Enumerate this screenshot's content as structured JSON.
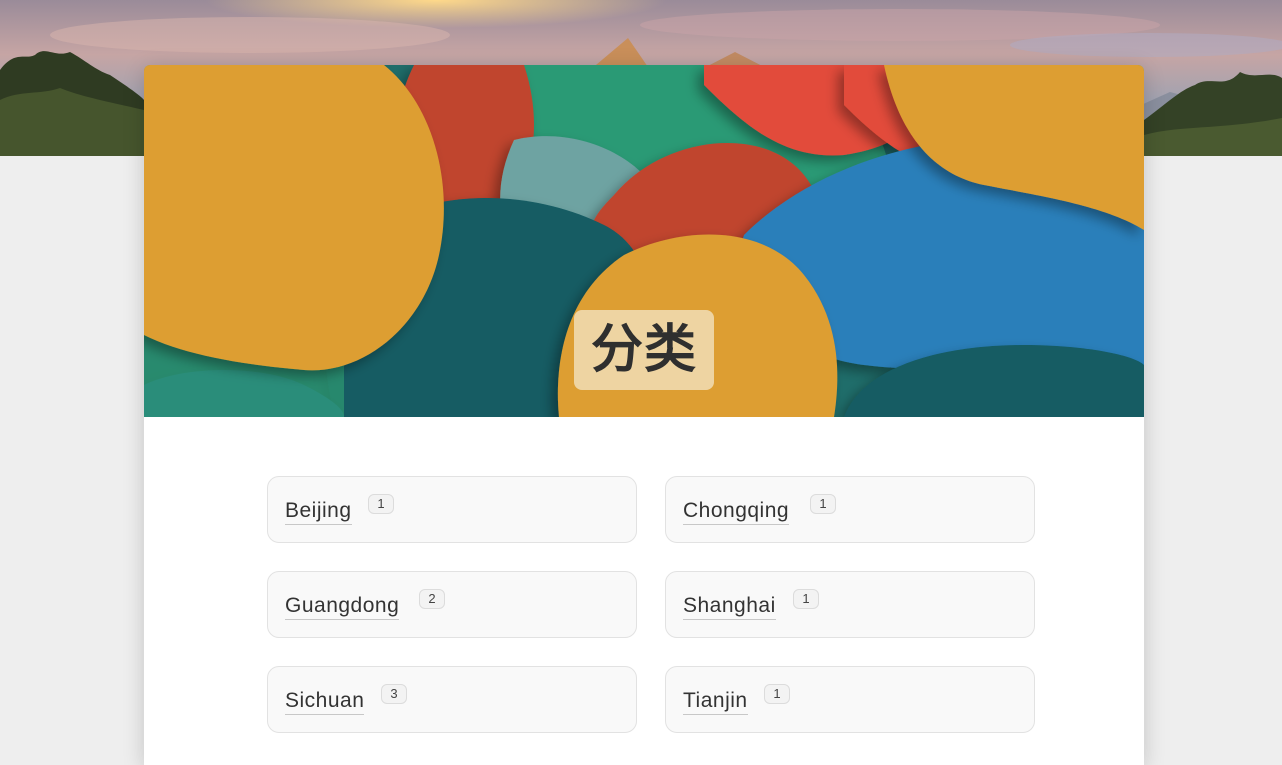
{
  "page": {
    "title": "分类"
  },
  "categories": [
    {
      "name": "Beijing",
      "count": "1"
    },
    {
      "name": "Chongqing",
      "count": "1"
    },
    {
      "name": "Guangdong",
      "count": "2"
    },
    {
      "name": "Shanghai",
      "count": "1"
    },
    {
      "name": "Sichuan",
      "count": "3"
    },
    {
      "name": "Tianjin",
      "count": "1"
    }
  ],
  "colors": {
    "page_background": "#eeeeee",
    "card_background": "#ffffff",
    "tile_background": "#f9f9f9",
    "banner_yellow": "#dd9e33",
    "banner_teal": "#135b63",
    "banner_blue": "#2a7fba",
    "banner_red": "#c0452f",
    "banner_green": "#2a8f6e"
  }
}
